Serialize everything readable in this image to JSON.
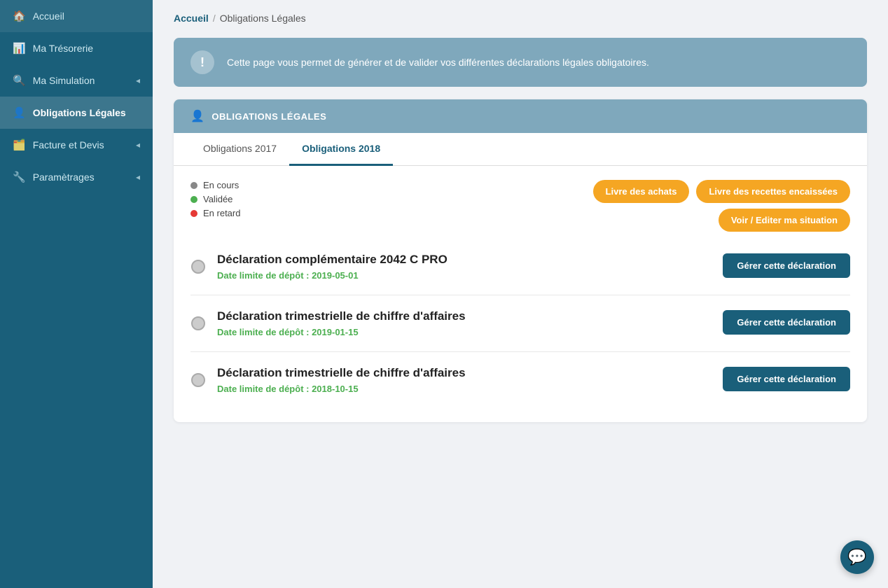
{
  "sidebar": {
    "items": [
      {
        "id": "accueil",
        "label": "Accueil",
        "icon": "🏠",
        "active": false,
        "chevron": false
      },
      {
        "id": "tresorerie",
        "label": "Ma Trésorerie",
        "icon": "📊",
        "active": false,
        "chevron": false
      },
      {
        "id": "simulation",
        "label": "Ma Simulation",
        "icon": "🔍",
        "active": false,
        "chevron": true
      },
      {
        "id": "obligations",
        "label": "Obligations Légales",
        "icon": "👤",
        "active": true,
        "chevron": false
      },
      {
        "id": "facture",
        "label": "Facture et Devis",
        "icon": "🗂️",
        "active": false,
        "chevron": true
      },
      {
        "id": "parametrages",
        "label": "Paramètrages",
        "icon": "🔧",
        "active": false,
        "chevron": true
      }
    ]
  },
  "breadcrumb": {
    "home": "Accueil",
    "separator": "/",
    "current": "Obligations Légales"
  },
  "infoBanner": {
    "icon": "!",
    "text": "Cette page vous permet de générer et de valider vos différentes déclarations légales obligatoires."
  },
  "section": {
    "header": {
      "icon": "👤",
      "title": "OBLIGATIONS LÉGALES"
    },
    "tabs": [
      {
        "id": "2017",
        "label": "Obligations 2017",
        "active": false
      },
      {
        "id": "2018",
        "label": "Obligations 2018",
        "active": true
      }
    ],
    "legend": [
      {
        "id": "en-cours",
        "color": "gray",
        "label": "En cours"
      },
      {
        "id": "validee",
        "color": "green",
        "label": "Validée"
      },
      {
        "id": "en-retard",
        "color": "red",
        "label": "En retard"
      }
    ],
    "actionButtons": [
      {
        "id": "livre-achats",
        "label": "Livre des achats"
      },
      {
        "id": "livre-recettes",
        "label": "Livre des recettes encaissées"
      },
      {
        "id": "voir-editer",
        "label": "Voir / Editer ma situation"
      }
    ],
    "declarations": [
      {
        "id": "decl-1",
        "title": "Déclaration complémentaire 2042 C PRO",
        "date": "Date limite de dépôt : 2019-05-01",
        "buttonLabel": "Gérer cette déclaration"
      },
      {
        "id": "decl-2",
        "title": "Déclaration trimestrielle de chiffre d'affaires",
        "date": "Date limite de dépôt : 2019-01-15",
        "buttonLabel": "Gérer cette déclaration"
      },
      {
        "id": "decl-3",
        "title": "Déclaration trimestrielle de chiffre d'affaires",
        "date": "Date limite de dépôt : 2018-10-15",
        "buttonLabel": "Gérer cette déclaration"
      }
    ]
  },
  "chat": {
    "icon": "💬"
  }
}
